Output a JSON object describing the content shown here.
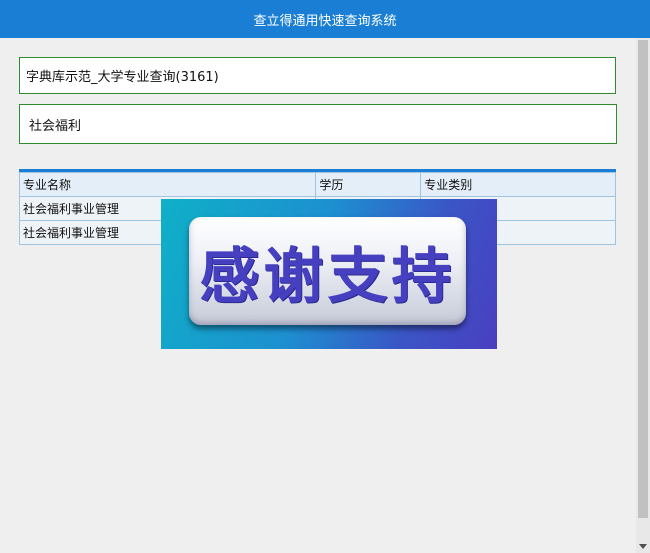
{
  "window": {
    "title": "查立得通用快速查询系统"
  },
  "header": {
    "dataset_title": "字典库示范_大学专业查询(3161)"
  },
  "search": {
    "query": "社会福利"
  },
  "table": {
    "columns": [
      "专业名称",
      "学历",
      "专业类别"
    ],
    "rows": [
      [
        "社会福利事业管理",
        "",
        ""
      ],
      [
        "社会福利事业管理",
        "",
        ""
      ]
    ]
  },
  "banner": {
    "text": "感谢支持"
  },
  "scrollbar": {
    "down_icon": "triangle-down-icon"
  },
  "colors": {
    "accent": "#1a7fd4",
    "border_green": "#2e8b2e",
    "banner_text": "#4640c0"
  }
}
